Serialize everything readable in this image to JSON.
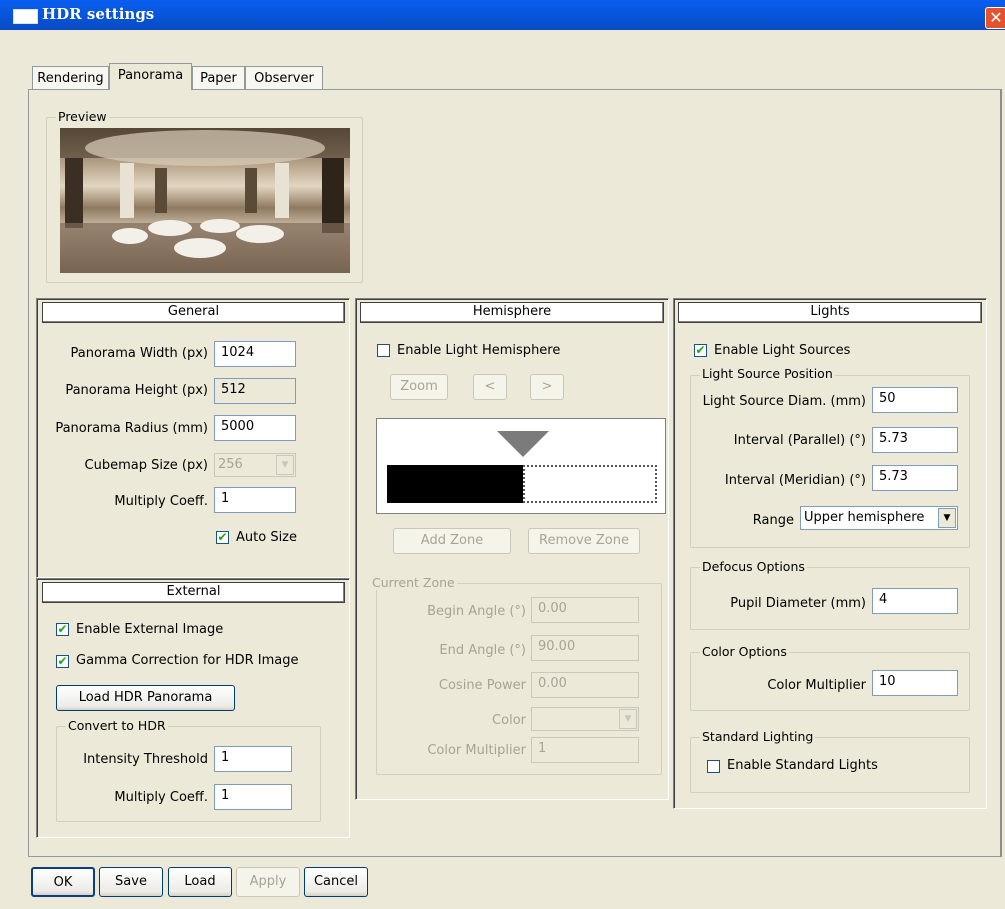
{
  "window": {
    "title": "HDR settings",
    "close": "✕"
  },
  "tabs": [
    "Rendering",
    "Panorama",
    "Paper",
    "Observer"
  ],
  "preview": {
    "label": "Preview"
  },
  "general": {
    "header": "General",
    "width_label": "Panorama Width (px)",
    "width_value": "1024",
    "height_label": "Panorama Height (px)",
    "height_value": "512",
    "radius_label": "Panorama Radius (mm)",
    "radius_value": "5000",
    "cubemap_label": "Cubemap Size (px)",
    "cubemap_value": "256",
    "multiply_label": "Multiply Coeff.",
    "multiply_value": "1",
    "autosize_label": "Auto Size"
  },
  "external": {
    "header": "External",
    "enable_label": "Enable External Image",
    "gamma_label": "Gamma Correction for HDR Image",
    "load_button": "Load HDR Panorama",
    "convert_group": "Convert to HDR",
    "threshold_label": "Intensity Threshold",
    "threshold_value": "1",
    "multiply_label": "Multiply Coeff.",
    "multiply_value": "1"
  },
  "hemisphere": {
    "header": "Hemisphere",
    "enable_label": "Enable Light Hemisphere",
    "zoom_button": "Zoom",
    "prev_button": "<",
    "next_button": ">",
    "add_zone_button": "Add Zone",
    "remove_zone_button": "Remove Zone",
    "current_zone_group": "Current Zone",
    "begin_label": "Begin Angle (°)",
    "begin_value": "0.00",
    "end_label": "End Angle (°)",
    "end_value": "90.00",
    "cosine_label": "Cosine Power",
    "cosine_value": "0.00",
    "color_label": "Color",
    "color_mult_label": "Color Multiplier",
    "color_mult_value": "1"
  },
  "lights": {
    "header": "Lights",
    "enable_label": "Enable Light Sources",
    "position_group": "Light Source Position",
    "diam_label": "Light Source Diam. (mm)",
    "diam_value": "50",
    "parallel_label": "Interval (Parallel) (°)",
    "parallel_value": "5.73",
    "meridian_label": "Interval (Meridian) (°)",
    "meridian_value": "5.73",
    "range_label": "Range",
    "range_value": "Upper hemisphere",
    "defocus_group": "Defocus Options",
    "pupil_label": "Pupil Diameter (mm)",
    "pupil_value": "4",
    "color_group": "Color Options",
    "color_mult_label": "Color Multiplier",
    "color_mult_value": "10",
    "standard_group": "Standard Lighting",
    "standard_label": "Enable Standard Lights"
  },
  "footer": {
    "ok": "OK",
    "save": "Save",
    "load": "Load",
    "apply": "Apply",
    "cancel": "Cancel"
  },
  "icons": {
    "check": "✔",
    "dropdown": "▼"
  }
}
